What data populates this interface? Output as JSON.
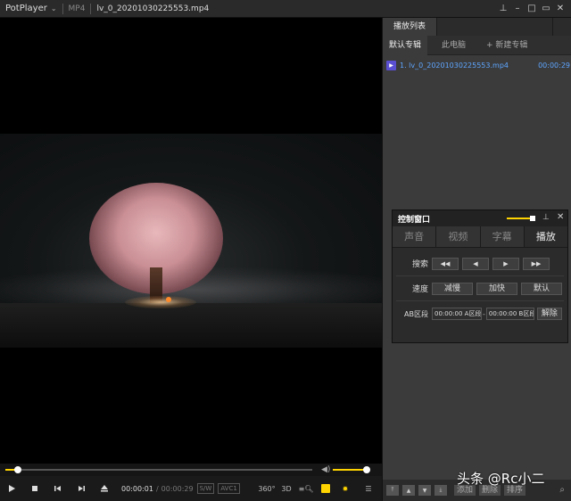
{
  "titlebar": {
    "app_name": "PotPlayer",
    "format": "MP4",
    "filename": "lv_0_20201030225553.mp4"
  },
  "playback": {
    "current_time": "00:00:01",
    "total_time": "00:00:29",
    "position_fraction": 0.04,
    "volume_fraction": 0.95,
    "sw_badge": "S/W",
    "codec_badge": "AVC1",
    "btn_360": "360°",
    "btn_3d": "3D"
  },
  "playlist": {
    "tab_label": "播放列表",
    "subtabs": [
      "默认专辑",
      "此电脑",
      "+ 新建专辑"
    ],
    "items": [
      {
        "name": "1. lv_0_20201030225553.mp4",
        "duration": "00:00:29"
      }
    ],
    "bottom_buttons": [
      "添加",
      "删除",
      "排序"
    ]
  },
  "control_window": {
    "title": "控制窗口",
    "tabs": [
      "声音",
      "视频",
      "字幕",
      "播放"
    ],
    "active_tab": "播放",
    "search_label": "搜索",
    "speed_label": "速度",
    "speed_buttons": [
      "减慢",
      "加快",
      "默认"
    ],
    "ab_label": "AB区段",
    "ab_a_value": "00:00:00 A区段",
    "ab_b_value": "00:00:00 B区段",
    "ab_clear": "解除"
  },
  "watermark": "头条 @Rc小二",
  "colors": {
    "accent": "#ffd400",
    "playlist_item": "#5ea6ff"
  }
}
